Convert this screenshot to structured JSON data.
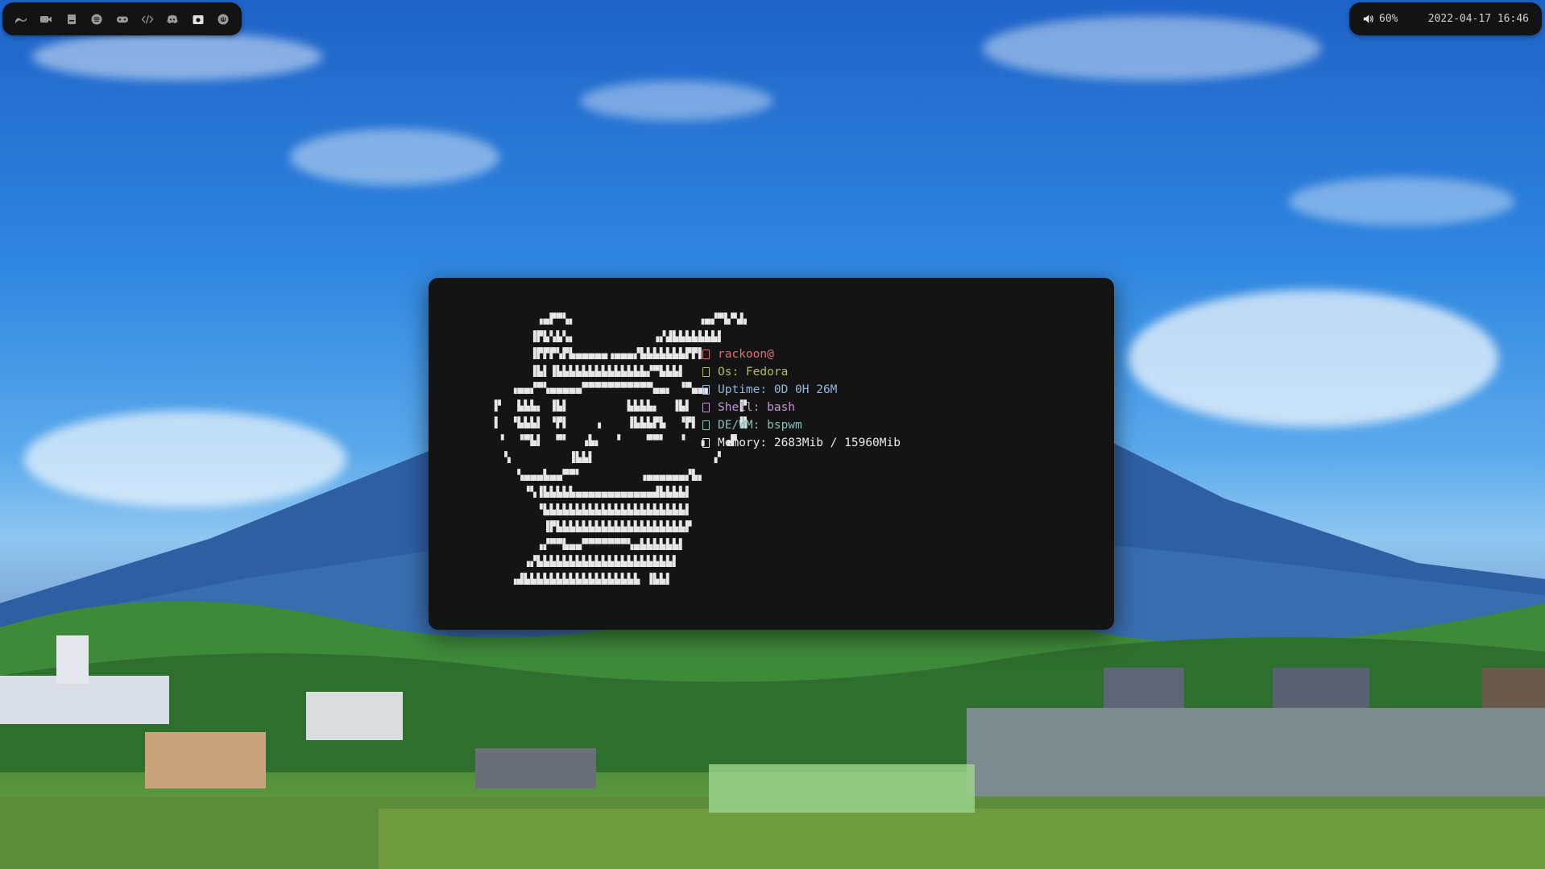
{
  "topbar_left": {
    "workspaces": [
      {
        "icon": "wave-icon"
      },
      {
        "icon": "video-camera-icon"
      },
      {
        "icon": "book-icon"
      },
      {
        "icon": "spotify-icon"
      },
      {
        "icon": "gamepad-icon"
      },
      {
        "icon": "code-icon"
      },
      {
        "icon": "discord-icon"
      },
      {
        "icon": "camera-icon"
      },
      {
        "icon": "power-icon"
      }
    ]
  },
  "topbar_right": {
    "volume_icon": "speaker-icon",
    "volume": "60%",
    "datetime": "2022-04-17 16:46"
  },
  "terminal": {
    "ascii_art": "            ▗▄▛▀▚▖                   ▗▄▞▀▙▀▟▖\n           ▐▛▙▚▙▚▖            ▗▞▟▙▙▙▙▙▙▙▌\n           ▐▛▛▛▚▛▙▄▄▄▄▄▗▄▄▄▞▙▙▙▙▙▙▙▛▛▌\n           ▐▙▌▐▙▙▙▙▙▙▙▙▙▙▙▙▙▙▞▀▙▙▙▌\n        ▗▄▄▞▀▚▄▄▄▄▄▀▀▀▀▀▀▀▀▀▀▀▄▄▖ ▝▀▄▄▖\n     ▐▘  ▙▙▙▖ ▐▙▌         ▙▙▙▙▖  ▐▙▌       ▐▘\n     ▐  ▝▙▙▙▌ ▝▛▌    ▗    ▐▙▙▙▛▙  ▝▛▌      ▐▌\n      ▝  ▝▀▙▌  ▀▘  ▗▙▖  ▝    ▀▀▘  ▝  ▗   ▗▛\n       ▚         ▐▙▙▌                  ▗▘\n         ▚▄▄▄▙▄▄▀▀▘         ▗▄▄▄▄▄▄▞▙▖\n          ▝▚▐▙▙▙▙▙▄▄▄▄▄▄▄▄▄▄▄▄▟▙▙▙▙▌\n            ▝▙▙▙▙▙▙▙▙▙▙▙▙▙▙▙▙▙▙▙▙▙▙▌\n             ▐▛▙▙▙▙▙▙▙▙▙▙▙▙▙▙▙▙▙▙▙▙▛\n            ▗▞▀▀▙▄▄▀▀▀▀▀▀▀▚▄▙▙▙▙▙▙▌\n          ▗▞▙▙▙▙▙▙▙▙▙▙▙▙▙▙▙▙▙▙▙▙▙▌\n        ▗▟▙▙▙▙▙▙▙▙▙▙▙▙▙▙▙▙▙▙ ▐▙▙▌",
    "info": [
      {
        "icon": "square-icon",
        "text": "rackoon@",
        "color": "#e06c75"
      },
      {
        "icon": "square-icon",
        "text": "Os: Fedora",
        "color": "#b5bd68"
      },
      {
        "icon": "square-icon",
        "text": "Uptime: 0D 0H 26M",
        "color": "#8fb6e0"
      },
      {
        "icon": "square-icon",
        "text": "Shell: bash",
        "color": "#c397d8"
      },
      {
        "icon": "square-icon",
        "text": "DE/WM: bspwm",
        "color": "#8abeb7"
      },
      {
        "icon": "square-icon",
        "text": "Memory: 2683Mib / 15960Mib",
        "color": "#eaeaea"
      }
    ]
  }
}
